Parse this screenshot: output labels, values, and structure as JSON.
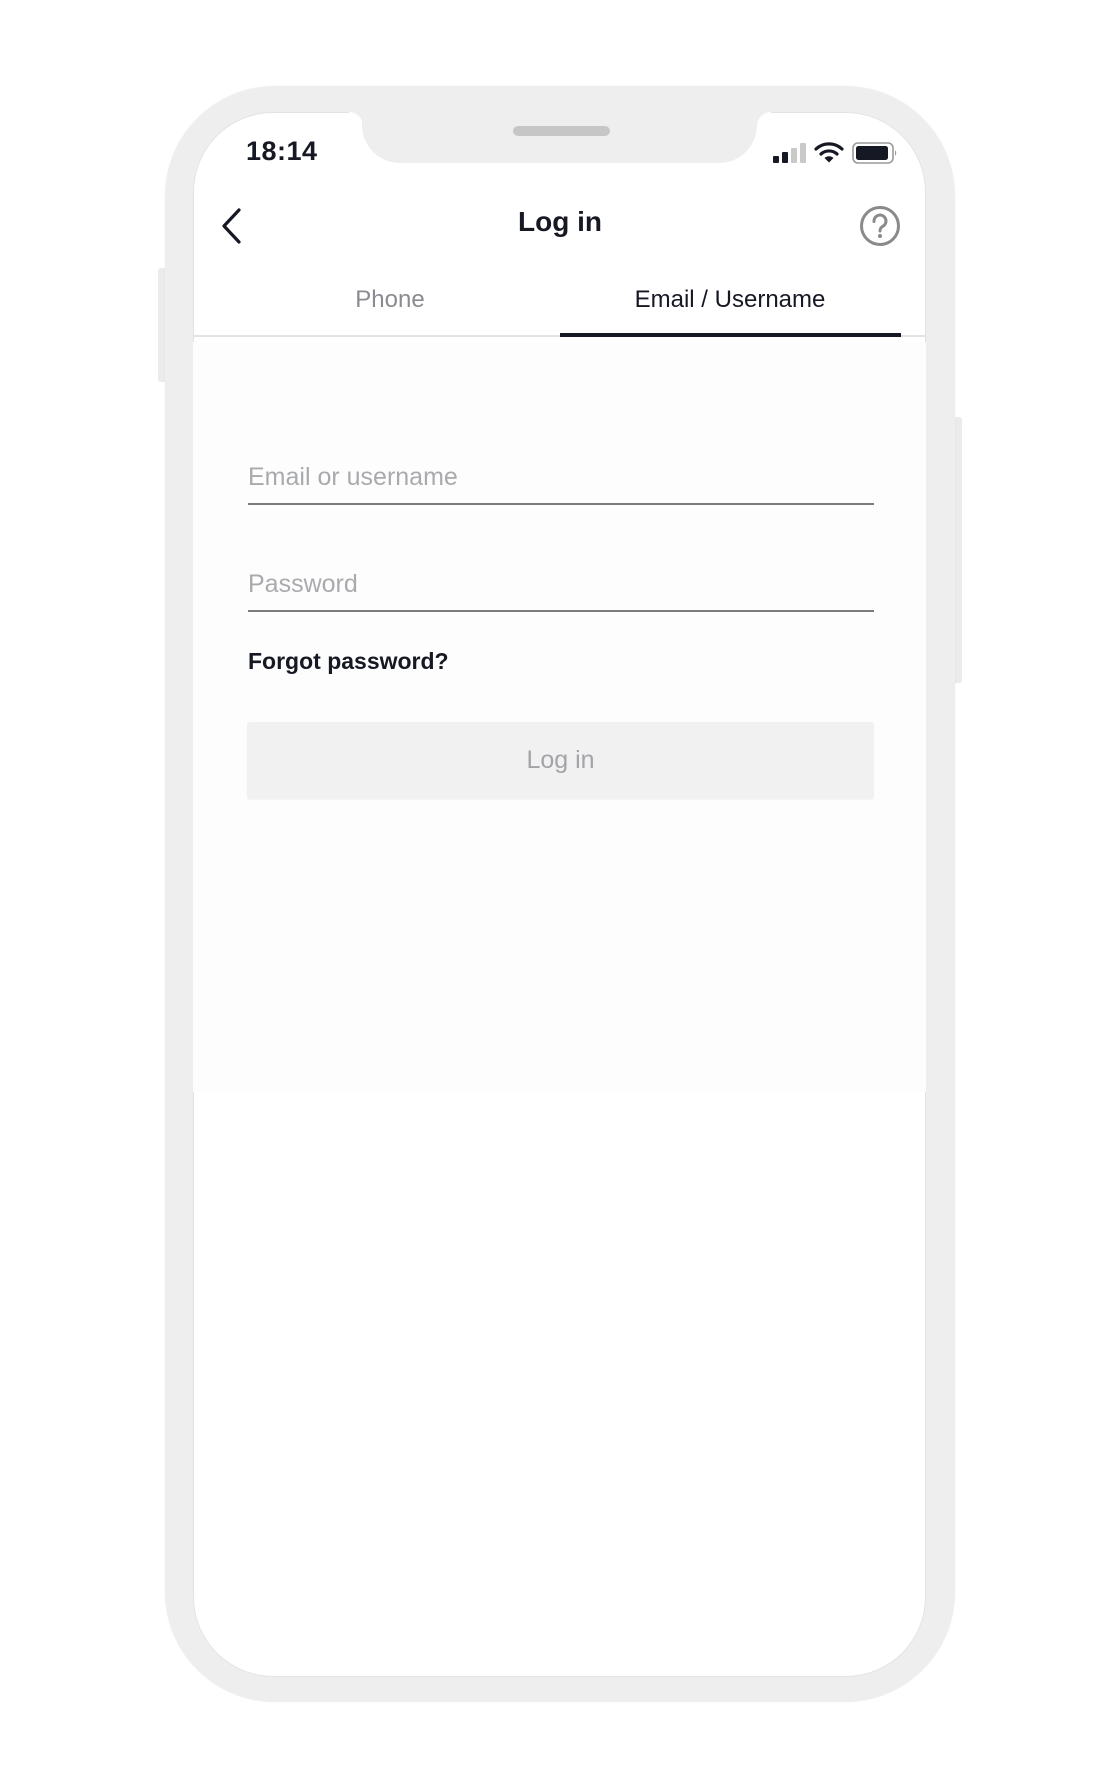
{
  "status_bar": {
    "time": "18:14",
    "signal_bars_active": 2,
    "signal_bars_total": 4,
    "signal_icon": "cellular-signal-icon",
    "wifi_icon": "wifi-icon",
    "battery_icon": "battery-icon"
  },
  "nav": {
    "title": "Log in",
    "back_icon": "chevron-left-icon",
    "help_icon": "question-circle-icon"
  },
  "tabs": [
    {
      "label": "Phone",
      "active": false
    },
    {
      "label": "Email / Username",
      "active": true
    }
  ],
  "form": {
    "email": {
      "value": "",
      "placeholder": "Email or username"
    },
    "password": {
      "value": "",
      "placeholder": "Password"
    },
    "forgot_password_label": "Forgot password?",
    "submit_label": "Log in",
    "submit_enabled": false
  },
  "colors": {
    "text_primary": "#161823",
    "text_secondary": "#8a8b91",
    "placeholder": "#a9aaad",
    "button_disabled_bg": "#f1f1f2",
    "button_disabled_text": "#a3a4a8",
    "frame": "#eeeeee"
  }
}
